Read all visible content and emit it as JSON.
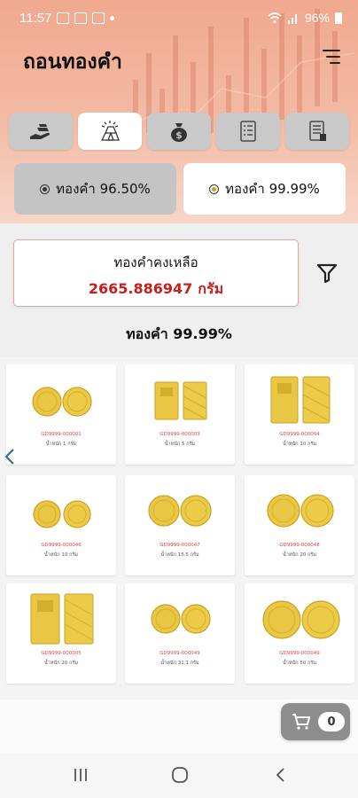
{
  "status_bar": {
    "time": "11:57",
    "battery": "96%"
  },
  "header": {
    "title": "ถอนทองคำ"
  },
  "category_tabs": [
    {
      "icon": "hand-gold-icon",
      "active": false
    },
    {
      "icon": "gold-bars-icon",
      "active": true
    },
    {
      "icon": "money-bag-icon",
      "active": false
    },
    {
      "icon": "checklist-icon",
      "active": false
    },
    {
      "icon": "report-icon",
      "active": false
    }
  ],
  "purity": {
    "option_965": "ทองคำ 96.50%",
    "option_9999": "ทองคำ 99.99%",
    "selected": "ทองคำ 99.99%"
  },
  "balance": {
    "label": "ทองคำคงเหลือ",
    "value": "2665.886947",
    "unit": "กรัม"
  },
  "section_title": "ทองคำ 99.99%",
  "products": [
    {
      "type": "coin-pair",
      "code": "GD9999-000001",
      "weight": "น้ำหนัก 1 กรัม"
    },
    {
      "type": "bar-pair",
      "code": "GD9999-000003",
      "weight": "น้ำหนัก 5 กรัม"
    },
    {
      "type": "bar-pair-large",
      "code": "GD9999-000004",
      "weight": "น้ำหนัก 10 กรัม"
    },
    {
      "type": "coin-pair",
      "code": "GD9999-000046",
      "weight": "น้ำหนัก 10 กรัม"
    },
    {
      "type": "coin-pair-large",
      "code": "GD9999-000047",
      "weight": "น้ำหนัก 15.5 กรัม"
    },
    {
      "type": "coin-pair-large",
      "code": "GD9999-000048",
      "weight": "น้ำหนัก 20 กรัม"
    },
    {
      "type": "bar-pair-large",
      "code": "GD9999-000005",
      "weight": "น้ำหนัก 20 กรัม"
    },
    {
      "type": "coin-pair-large",
      "code": "GD9999-000049",
      "weight": "น้ำหนัก 31.1 กรัม"
    },
    {
      "type": "coin-pair-xl",
      "code": "GD9999-000049",
      "weight": "น้ำหนัก 50 กรัม"
    }
  ],
  "cart": {
    "count": "0"
  },
  "colors": {
    "accent_red": "#c81e1e",
    "gold": "#e8c441",
    "hero_top": "#f0a98f"
  }
}
